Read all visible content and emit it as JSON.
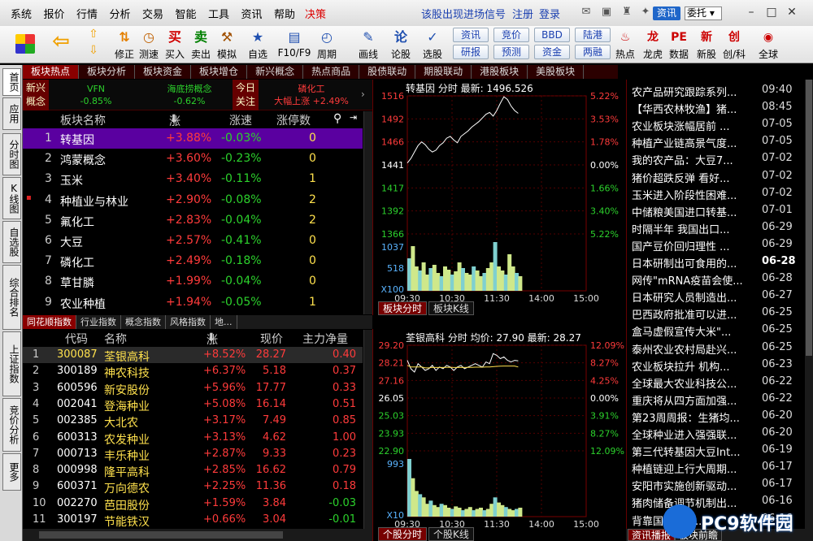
{
  "menubar": {
    "items": [
      "系统",
      "报价",
      "行情",
      "分析",
      "交易",
      "智能",
      "工具",
      "资讯",
      "帮助"
    ],
    "decision": "决策",
    "signal": "该股出现进场信号",
    "register": "注册",
    "login": "登录",
    "btn_zixun": "资讯",
    "btn_weituo": "委托"
  },
  "toolbar": {
    "buttons": [
      {
        "label": "修正",
        "icon": "⇅",
        "color": "#e48000"
      },
      {
        "label": "测速",
        "icon": "◷",
        "color": "#c06000"
      },
      {
        "label": "买入",
        "icon": "买",
        "color": "#d00000"
      },
      {
        "label": "卖出",
        "icon": "卖",
        "color": "#008000"
      },
      {
        "label": "模拟",
        "icon": "⚒",
        "color": "#a05000"
      },
      {
        "label": "自选",
        "icon": "★",
        "color": "#2050b0"
      },
      {
        "label": "F10/F9",
        "icon": "▤",
        "color": "#2050b0"
      },
      {
        "label": "周期",
        "icon": "◴",
        "color": "#2050b0"
      },
      {
        "label": "画线",
        "icon": "✎",
        "color": "#2050b0"
      },
      {
        "label": "论股",
        "icon": "论",
        "color": "#2050b0"
      },
      {
        "label": "选股",
        "icon": "✓",
        "color": "#2050b0"
      }
    ],
    "small": [
      [
        "资讯",
        "研报"
      ],
      [
        "竞价",
        "预测"
      ],
      [
        "BBD",
        "资金"
      ],
      [
        "陆港",
        "两融"
      ]
    ],
    "right": [
      {
        "label": "热点",
        "icon": "♨"
      },
      {
        "label": "龙虎",
        "icon": "龙"
      },
      {
        "label": "数据",
        "icon": "PE"
      },
      {
        "label": "新股",
        "icon": "新"
      },
      {
        "label": "创/科",
        "icon": "创"
      },
      {
        "label": "全球",
        "icon": "◉"
      }
    ]
  },
  "sidebar": [
    "首页",
    "应用",
    "分时图",
    "K线图",
    "自选股",
    "综合排名",
    "上证指数",
    "竞价分析",
    "更多"
  ],
  "section_tabs": [
    "板块热点",
    "板块分析",
    "板块资金",
    "板块增仓",
    "新兴概念",
    "热点商品",
    "股债联动",
    "期股联动",
    "港股板块",
    "美股板块"
  ],
  "ticker": {
    "label1": "新兴概念",
    "items": [
      {
        "name": "VFN",
        "chg": "-0.85%"
      },
      {
        "name": "海底捞概念",
        "chg": "-0.62%"
      }
    ],
    "label2": "今日关注",
    "focus": {
      "name": "磷化工",
      "desc": "大幅上涨",
      "chg": "+2.49%"
    }
  },
  "sector_table": {
    "headers": {
      "name": "板块名称",
      "chg": "涨幅",
      "speed": "涨速",
      "count": "涨停数"
    },
    "rows": [
      {
        "no": "1",
        "name": "转基因",
        "chg": "+3.88%",
        "speed": "-0.03%",
        "count": "0"
      },
      {
        "no": "2",
        "name": "鸿蒙概念",
        "chg": "+3.60%",
        "speed": "-0.23%",
        "count": "0"
      },
      {
        "no": "3",
        "name": "玉米",
        "chg": "+3.40%",
        "speed": "-0.11%",
        "count": "1"
      },
      {
        "no": "4",
        "name": "种植业与林业",
        "chg": "+2.90%",
        "speed": "-0.08%",
        "count": "2"
      },
      {
        "no": "5",
        "name": "氟化工",
        "chg": "+2.83%",
        "speed": "-0.04%",
        "count": "2"
      },
      {
        "no": "6",
        "name": "大豆",
        "chg": "+2.57%",
        "speed": "-0.41%",
        "count": "0"
      },
      {
        "no": "7",
        "name": "磷化工",
        "chg": "+2.49%",
        "speed": "-0.18%",
        "count": "0"
      },
      {
        "no": "8",
        "name": "草甘膦",
        "chg": "+1.99%",
        "speed": "-0.04%",
        "count": "0"
      },
      {
        "no": "9",
        "name": "农业种植",
        "chg": "+1.94%",
        "speed": "-0.05%",
        "count": "1"
      }
    ]
  },
  "bottom_tabs": [
    "同花顺指数",
    "行业指数",
    "概念指数",
    "风格指数",
    "地..."
  ],
  "stock_table": {
    "headers": {
      "code": "代码",
      "name": "名称",
      "chg": "涨幅",
      "price": "现价",
      "net": "主力净量"
    },
    "rows": [
      {
        "no": "1",
        "code": "300087",
        "name": "荃银高科",
        "chg": "+8.52%",
        "price": "28.27",
        "net": "0.40"
      },
      {
        "no": "2",
        "code": "300189",
        "name": "神农科技",
        "chg": "+6.37%",
        "price": "5.18",
        "net": "0.37"
      },
      {
        "no": "3",
        "code": "600596",
        "name": "新安股份",
        "chg": "+5.96%",
        "price": "17.77",
        "net": "0.33"
      },
      {
        "no": "4",
        "code": "002041",
        "name": "登海种业",
        "chg": "+5.08%",
        "price": "16.14",
        "net": "0.51"
      },
      {
        "no": "5",
        "code": "002385",
        "name": "大北农",
        "chg": "+3.17%",
        "price": "7.49",
        "net": "0.85"
      },
      {
        "no": "6",
        "code": "600313",
        "name": "农发种业",
        "chg": "+3.13%",
        "price": "4.62",
        "net": "1.00"
      },
      {
        "no": "7",
        "code": "000713",
        "name": "丰乐种业",
        "chg": "+2.87%",
        "price": "9.33",
        "net": "0.23"
      },
      {
        "no": "8",
        "code": "000998",
        "name": "隆平高科",
        "chg": "+2.85%",
        "price": "16.62",
        "net": "0.79"
      },
      {
        "no": "9",
        "code": "600371",
        "name": "万向德农",
        "chg": "+2.25%",
        "price": "11.36",
        "net": "0.18"
      },
      {
        "no": "10",
        "code": "002270",
        "name": "芭田股份",
        "chg": "+1.59%",
        "price": "3.84",
        "net": "-0.03"
      },
      {
        "no": "11",
        "code": "300197",
        "name": "节能铁汉",
        "chg": "+0.66%",
        "price": "3.04",
        "net": "-0.01"
      }
    ]
  },
  "chart_data": [
    {
      "type": "line",
      "title": "转基因 分时 最新: 1496.526",
      "x_ticks": [
        "09:30",
        "10:30",
        "11:30",
        "14:00",
        "15:00"
      ],
      "y_ticks": [
        "1516",
        "1492",
        "1466",
        "1441",
        "1417",
        "1392",
        "1366"
      ],
      "pct_ticks": [
        "5.22%",
        "3.53%",
        "1.78%",
        "0.00%",
        "1.66%",
        "3.40%",
        "5.22%"
      ],
      "vol_ticks": [
        "1037",
        "518",
        "X100"
      ],
      "series": [
        {
          "values": [
            1443,
            1448,
            1455,
            1462,
            1466,
            1463,
            1458,
            1455,
            1457,
            1462,
            1465,
            1470,
            1472,
            1468,
            1465,
            1472,
            1475,
            1478,
            1482,
            1485,
            1488,
            1492,
            1496,
            1498,
            1494,
            1500,
            1508,
            1515,
            1512,
            1505,
            1500,
            1497
          ]
        }
      ],
      "volume": [
        40,
        55,
        30,
        25,
        35,
        20,
        28,
        32,
        22,
        18,
        30,
        26,
        20,
        24,
        35,
        28,
        22,
        20,
        30,
        25,
        18,
        22,
        28,
        35,
        60,
        30,
        25,
        20,
        45,
        30,
        22,
        18
      ],
      "ylim": [
        1366,
        1516
      ],
      "tabs": [
        "板块分时",
        "板块K线"
      ]
    },
    {
      "type": "line",
      "title": "荃银高科 分时 均价: 27.90 最新: 28.27",
      "x_ticks": [
        "09:30",
        "10:30",
        "11:30",
        "14:00",
        "15:00"
      ],
      "y_ticks": [
        "29.20",
        "28.21",
        "27.16",
        "26.05",
        "25.03",
        "23.93",
        "22.90"
      ],
      "pct_ticks": [
        "12.09%",
        "8.27%",
        "4.25%",
        "0.00%",
        "3.91%",
        "8.27%",
        "12.09%"
      ],
      "vol_ticks": [
        "993",
        "X10"
      ],
      "series": [
        {
          "values": [
            28.3,
            27.8,
            27.6,
            28.1,
            27.9,
            27.7,
            27.8,
            28.0,
            27.7,
            27.9,
            27.8,
            28.0,
            27.9,
            27.7,
            27.9,
            28.0,
            27.8,
            27.9,
            28.0,
            28.1,
            28.0,
            27.9,
            28.2,
            28.1,
            28.7,
            28.6,
            28.4,
            28.5,
            28.3,
            28.2,
            28.3,
            28.27
          ]
        },
        {
          "name": "均价",
          "values": [
            28.0,
            27.9,
            27.9,
            27.9,
            27.9,
            27.85,
            27.85,
            27.88,
            27.87,
            27.87,
            27.87,
            27.88,
            27.88,
            27.87,
            27.87,
            27.88,
            27.87,
            27.88,
            27.88,
            27.89,
            27.89,
            27.89,
            27.9,
            27.9,
            27.92,
            27.94,
            27.95,
            27.96,
            27.96,
            27.96,
            27.96,
            27.9
          ]
        }
      ],
      "volume": [
        90,
        60,
        40,
        35,
        30,
        20,
        25,
        18,
        15,
        20,
        18,
        14,
        12,
        16,
        14,
        10,
        12,
        15,
        10,
        12,
        14,
        10,
        12,
        20,
        30,
        22,
        18,
        15,
        12,
        10,
        12,
        14
      ],
      "ylim": [
        22.9,
        29.2
      ],
      "tabs": [
        "个股分时",
        "个股K线"
      ]
    }
  ],
  "news": [
    {
      "title": "农产品研究跟踪系列...",
      "date": "09:40"
    },
    {
      "title": "【华西农林牧渔】猪...",
      "date": "08:45"
    },
    {
      "title": "农业板块涨幅居前 ...",
      "date": "07-05"
    },
    {
      "title": "种植产业链高景气度...",
      "date": "07-05"
    },
    {
      "title": "我的农产品：大豆7...",
      "date": "07-02"
    },
    {
      "title": "猪价超跌反弹 看好...",
      "date": "07-02"
    },
    {
      "title": "玉米进入阶段性困难...",
      "date": "07-02"
    },
    {
      "title": "中储粮美国进口转基...",
      "date": "07-01"
    },
    {
      "title": "时隔半年 我国出口...",
      "date": "06-29"
    },
    {
      "title": "国产豆价回归理性 ...",
      "date": "06-29"
    },
    {
      "title": "日本研制出可食用的...",
      "date": "06-28",
      "bold": true
    },
    {
      "title": "网传\"mRNA疫苗会使...",
      "date": "06-28"
    },
    {
      "title": "日本研究人员制造出...",
      "date": "06-27"
    },
    {
      "title": "巴西政府批准可以进...",
      "date": "06-25"
    },
    {
      "title": "盒马虚假宣传大米\"...",
      "date": "06-25"
    },
    {
      "title": "泰州农业农村局赴兴...",
      "date": "06-25"
    },
    {
      "title": "农业板块拉升 机构...",
      "date": "06-23"
    },
    {
      "title": "全球最大农业科技公...",
      "date": "06-22"
    },
    {
      "title": "重庆将从四方面加强...",
      "date": "06-22"
    },
    {
      "title": "第23周周报：生猪均...",
      "date": "06-20"
    },
    {
      "title": "全球种业进入强强联...",
      "date": "06-20"
    },
    {
      "title": "第三代转基因大豆Int...",
      "date": "06-19"
    },
    {
      "title": "种植链迎上行大周期...",
      "date": "06-17"
    },
    {
      "title": "安阳市实施创新驱动...",
      "date": "06-17"
    },
    {
      "title": "猪肉储备调节机制出...",
      "date": "06-16"
    },
    {
      "title": "背靠国际大型...",
      "date": "06-16"
    }
  ],
  "news_tabs": [
    "资讯播报",
    "板块前瞻"
  ],
  "watermark": "PC9软件园"
}
